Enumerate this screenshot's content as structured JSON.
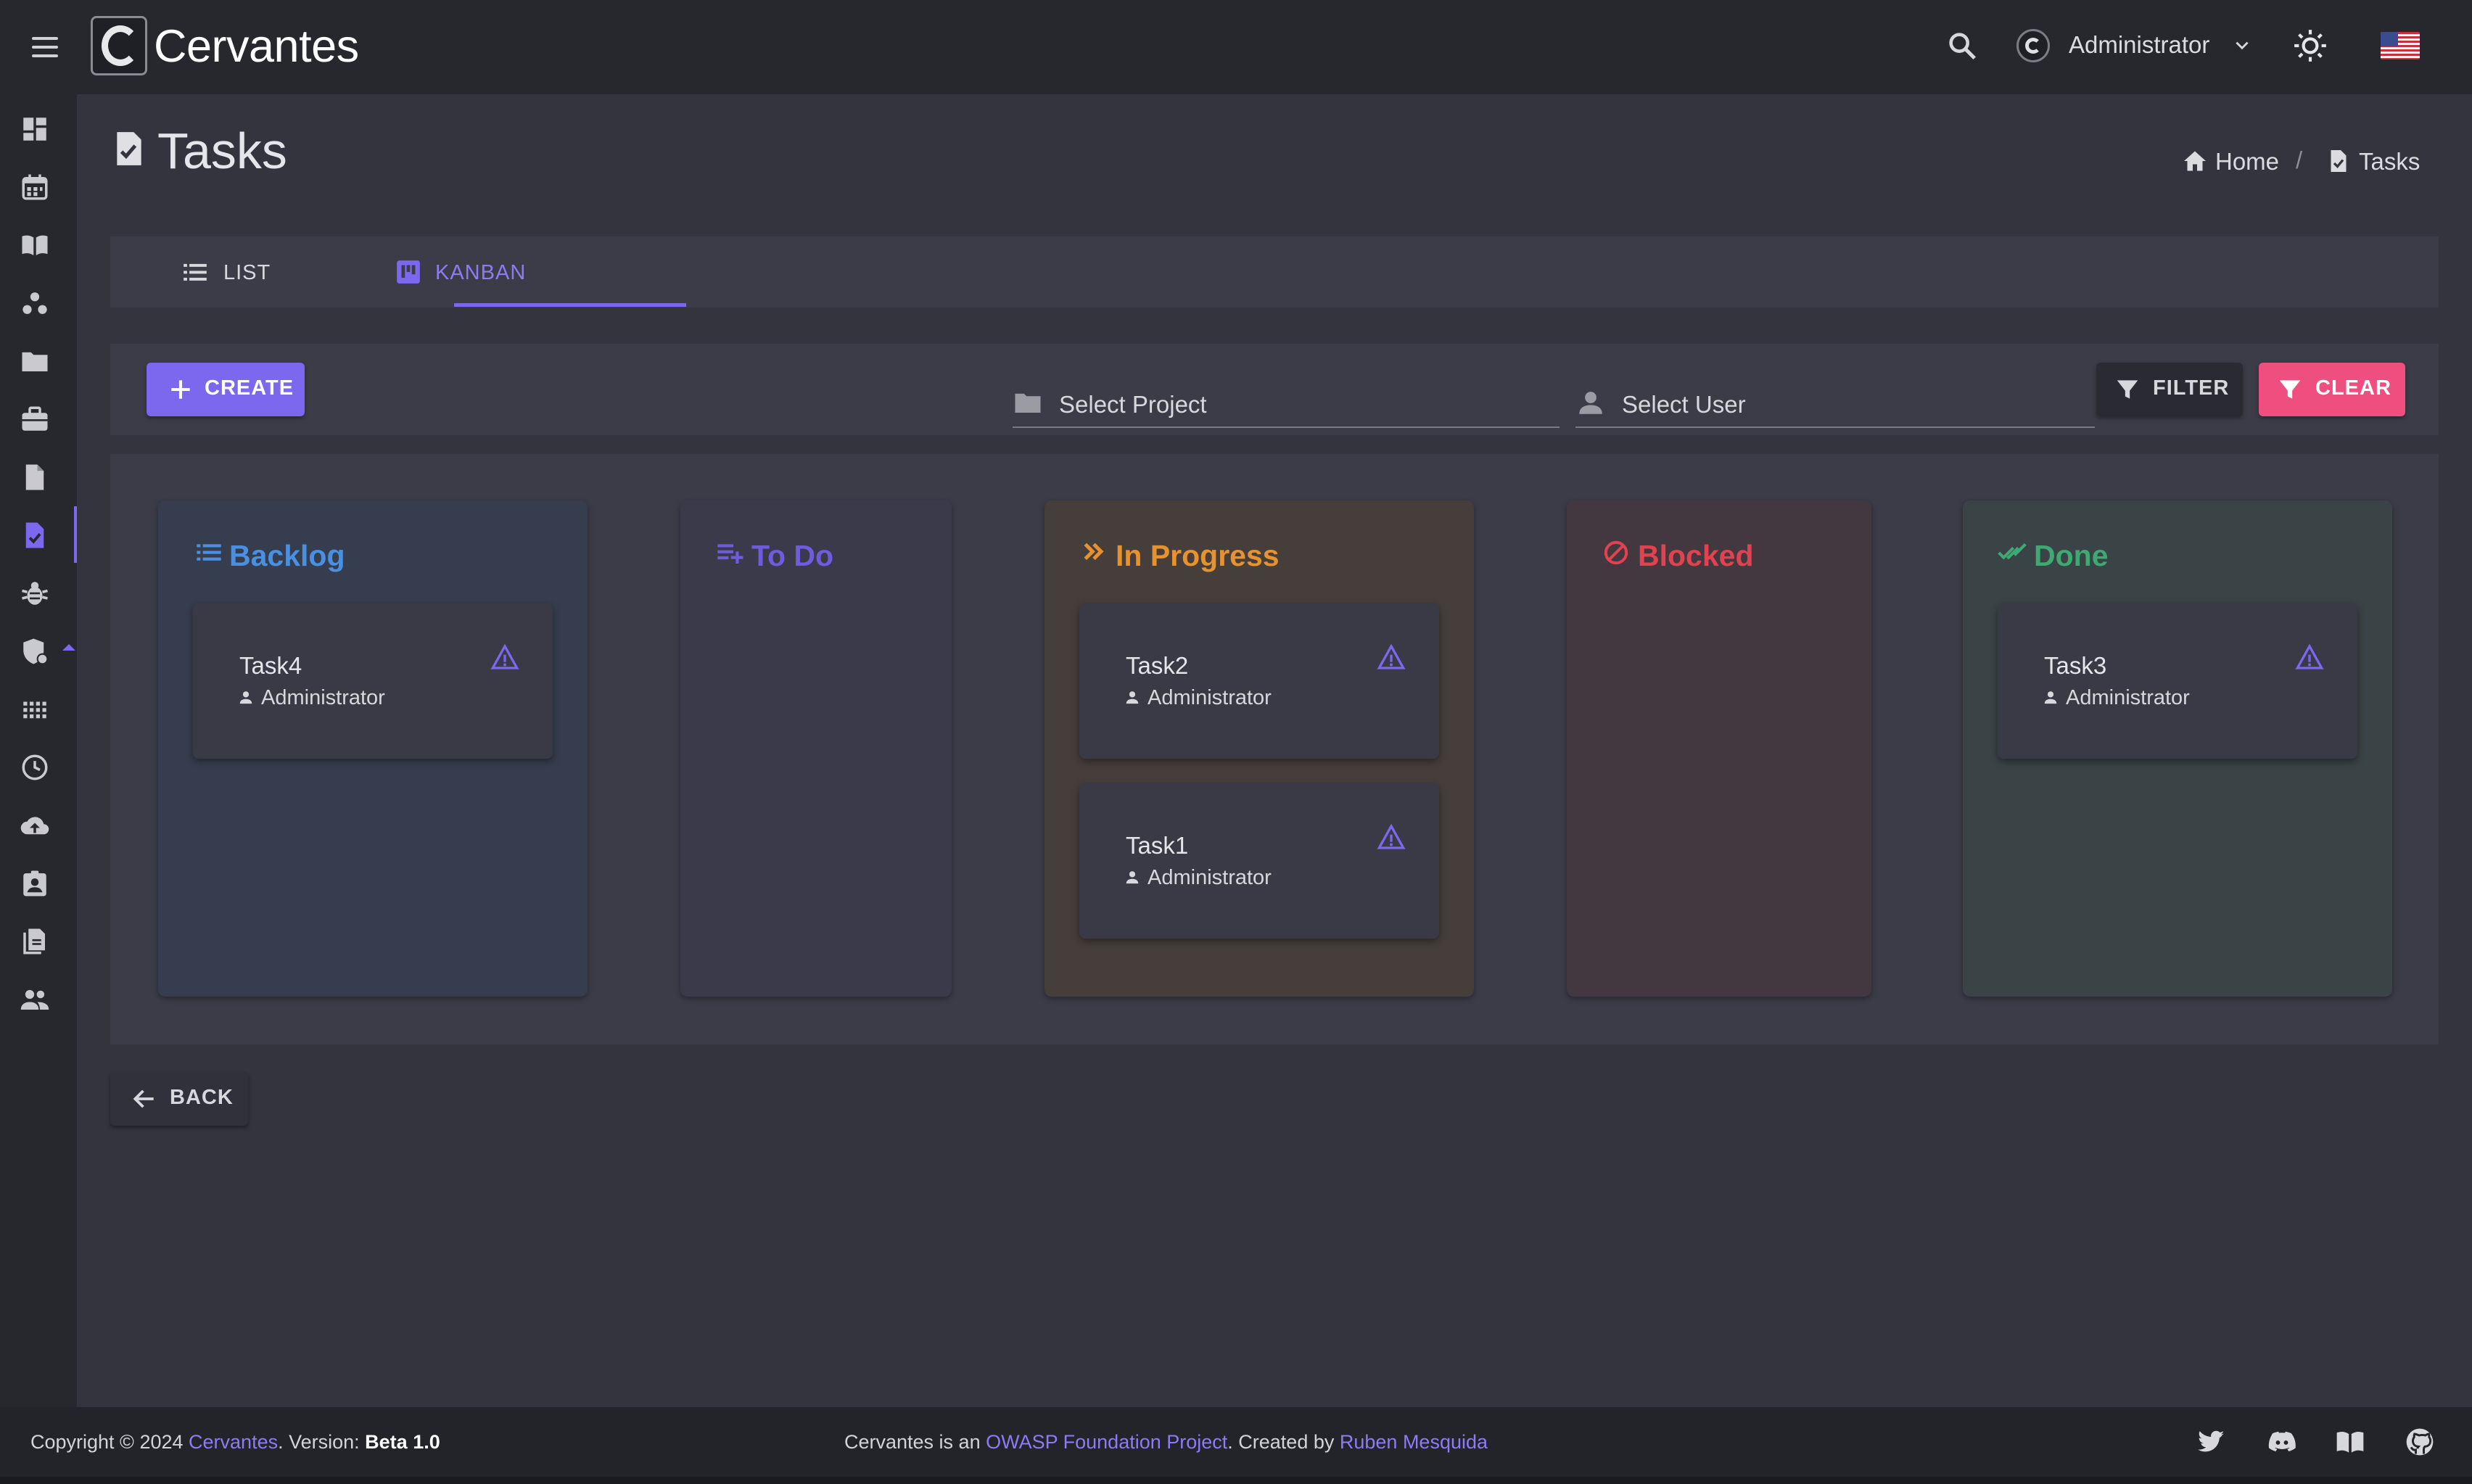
{
  "app": {
    "brand": "Cervantes",
    "user": "Administrator"
  },
  "page": {
    "title": "Tasks"
  },
  "breadcrumb": {
    "home": "Home",
    "current": "Tasks"
  },
  "tabs": [
    {
      "label": "LIST"
    },
    {
      "label": "KANBAN",
      "active": true
    }
  ],
  "toolbar": {
    "create": "CREATE",
    "project_placeholder": "Select Project",
    "user_placeholder": "Select User",
    "filter": "FILTER",
    "clear": "CLEAR"
  },
  "columns": [
    {
      "title": "Backlog",
      "color": "#4a90e2",
      "icon": "list-icon",
      "cards": [
        {
          "title": "Task4",
          "user": "Administrator"
        }
      ]
    },
    {
      "title": "To Do",
      "color": "#6f5bdb",
      "icon": "playlist-add-icon",
      "cards": []
    },
    {
      "title": "In Progress",
      "color": "#e6932f",
      "icon": "double-chevron-right-icon",
      "cards": [
        {
          "title": "Task2",
          "user": "Administrator"
        },
        {
          "title": "Task1",
          "user": "Administrator"
        }
      ]
    },
    {
      "title": "Blocked",
      "color": "#e0434f",
      "icon": "blocked-icon",
      "cards": []
    },
    {
      "title": "Done",
      "color": "#3fa873",
      "icon": "double-check-icon",
      "cards": [
        {
          "title": "Task3",
          "user": "Administrator"
        }
      ]
    }
  ],
  "back": "BACK",
  "footer": {
    "copyright_prefix": "Copyright © 2024",
    "copyright_link": "Cervantes",
    "version_prefix": ". Version:",
    "version": "Beta 1.0",
    "about_prefix": "Cervantes is an",
    "about_link": "OWASP Foundation Project",
    "created_by_prefix": ". Created by",
    "author": "Ruben Mesquida"
  },
  "colors": {
    "accent": "#7b68ee",
    "clear": "#ef4f7e"
  }
}
